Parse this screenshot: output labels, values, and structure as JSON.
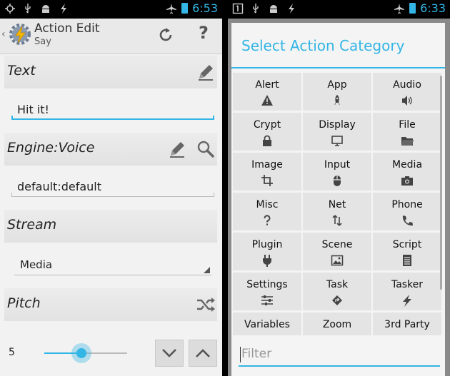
{
  "left": {
    "status_time": "6:53",
    "action_bar": {
      "title": "Action Edit",
      "subtitle": "Say"
    },
    "help_label": "?",
    "text_section": {
      "label": "Text",
      "value": "Hit it!"
    },
    "engine_section": {
      "label": "Engine:Voice",
      "value": "default:default"
    },
    "stream_section": {
      "label": "Stream",
      "value": "Media"
    },
    "pitch_section": {
      "label": "Pitch",
      "value": "5",
      "level": 0.45
    }
  },
  "right": {
    "status_time": "6:33",
    "dialog_title": "Select Action Category",
    "categories": [
      {
        "label": "Alert",
        "icon": "warning-icon"
      },
      {
        "label": "App",
        "icon": "rocket-icon"
      },
      {
        "label": "Audio",
        "icon": "speaker-icon"
      },
      {
        "label": "Crypt",
        "icon": "lock-icon"
      },
      {
        "label": "Display",
        "icon": "monitor-icon"
      },
      {
        "label": "File",
        "icon": "folder-icon"
      },
      {
        "label": "Image",
        "icon": "crop-icon"
      },
      {
        "label": "Input",
        "icon": "mouse-icon"
      },
      {
        "label": "Media",
        "icon": "camera-icon"
      },
      {
        "label": "Misc",
        "icon": "question-icon"
      },
      {
        "label": "Net",
        "icon": "updown-arrows-icon"
      },
      {
        "label": "Phone",
        "icon": "phone-icon"
      },
      {
        "label": "Plugin",
        "icon": "plug-icon"
      },
      {
        "label": "Scene",
        "icon": "picture-icon"
      },
      {
        "label": "Script",
        "icon": "script-icon"
      },
      {
        "label": "Settings",
        "icon": "sliders-icon"
      },
      {
        "label": "Task",
        "icon": "diamond-arrow-icon"
      },
      {
        "label": "Tasker",
        "icon": "lightning-icon"
      },
      {
        "label": "Variables",
        "icon": "variables-icon"
      },
      {
        "label": "Zoom",
        "icon": "zoom-icon"
      },
      {
        "label": "3rd Party",
        "icon": "third-party-icon"
      }
    ],
    "filter_placeholder": "Filter"
  },
  "colors": {
    "accent": "#33b5e5",
    "section_bg": "#e5e5e5",
    "page_bg": "#f2f2f2"
  }
}
